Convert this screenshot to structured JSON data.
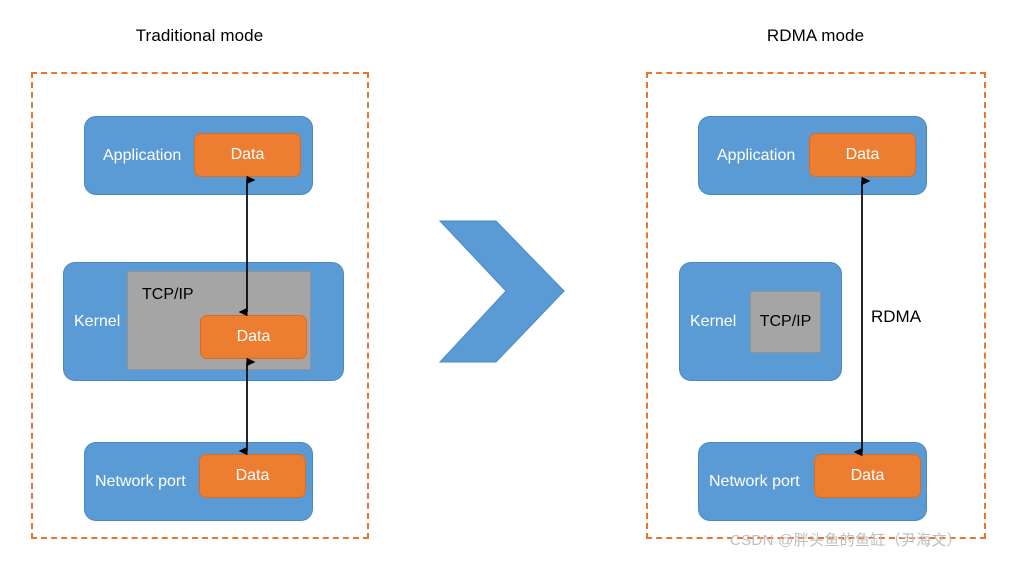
{
  "panels": {
    "traditional": {
      "title": "Traditional mode",
      "layers": [
        {
          "name": "application",
          "label": "Application",
          "data_label": "Data"
        },
        {
          "name": "kernel",
          "label": "Kernel",
          "tcpip_label": "TCP/IP",
          "data_label": "Data"
        },
        {
          "name": "network_port",
          "label": "Network port",
          "data_label": "Data"
        }
      ]
    },
    "rdma": {
      "title": "RDMA mode",
      "layers": [
        {
          "name": "application",
          "label": "Application",
          "data_label": "Data"
        },
        {
          "name": "kernel",
          "label": "Kernel",
          "tcpip_label": "TCP/IP"
        },
        {
          "name": "network_port",
          "label": "Network port",
          "data_label": "Data"
        }
      ],
      "arrow_label": "RDMA"
    }
  },
  "center_arrow": {
    "icon": "chevron-right-icon"
  },
  "watermark": {
    "text": "CSDN @胖头鱼的鱼缸（尹海文）"
  },
  "colors": {
    "layer_blue": "#5B9BD5",
    "data_orange": "#ED7D31",
    "tcpip_gray": "#A5A5A5",
    "frame_dashed_orange": "#E8762C",
    "arrow_black": "#000000",
    "watermark_gray": "#BFBFBF",
    "background": "#FFFFFF"
  }
}
